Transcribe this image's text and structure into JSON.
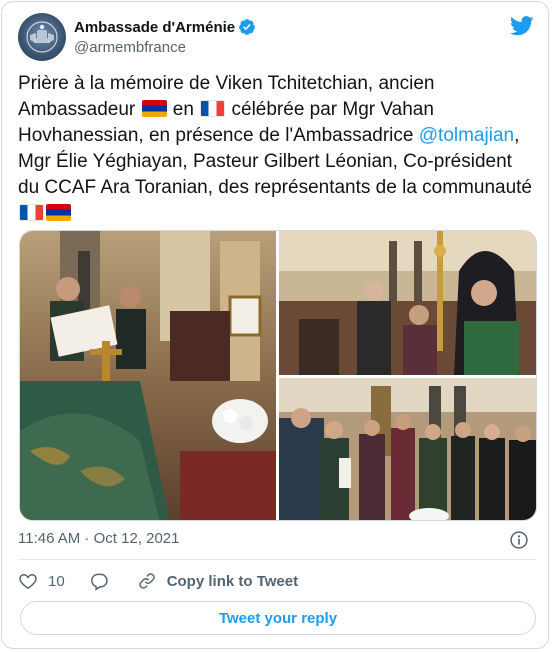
{
  "author": {
    "display_name": "Ambassade d'Arménie",
    "handle": "@armembfrance",
    "verified": true
  },
  "tweet": {
    "segments": [
      {
        "type": "text",
        "value": "Prière à la mémoire de Viken Tchitetchian, ancien Ambassadeur "
      },
      {
        "type": "flag",
        "value": "armenia"
      },
      {
        "type": "text",
        "value": " en "
      },
      {
        "type": "flag",
        "value": "france"
      },
      {
        "type": "text",
        "value": " célébrée par Mgr Vahan Hovhanessian, en présence de l'Ambassadrice "
      },
      {
        "type": "mention",
        "value": "@tolmajian"
      },
      {
        "type": "text",
        "value": ", Mgr Élie Yéghiayan, Pasteur Gilbert Léonian, Co-président du CCAF Ara Toranian, des représentants de la communauté "
      },
      {
        "type": "flag",
        "value": "france"
      },
      {
        "type": "flag",
        "value": "armenia"
      }
    ]
  },
  "timestamp": "11:46 AM · Oct 12, 2021",
  "actions": {
    "like_count": "10",
    "copy_link_label": "Copy link to Tweet"
  },
  "reply_button_label": "Tweet your reply",
  "icons": {
    "brand": "twitter-bird-icon",
    "verified": "verified-badge-icon",
    "info": "info-icon",
    "like": "heart-icon",
    "reply": "speech-bubble-icon",
    "copy": "link-icon"
  },
  "colors": {
    "accent": "#1d9bf0",
    "text": "#0f1419",
    "secondary": "#536471",
    "border": "#cfd9de"
  }
}
